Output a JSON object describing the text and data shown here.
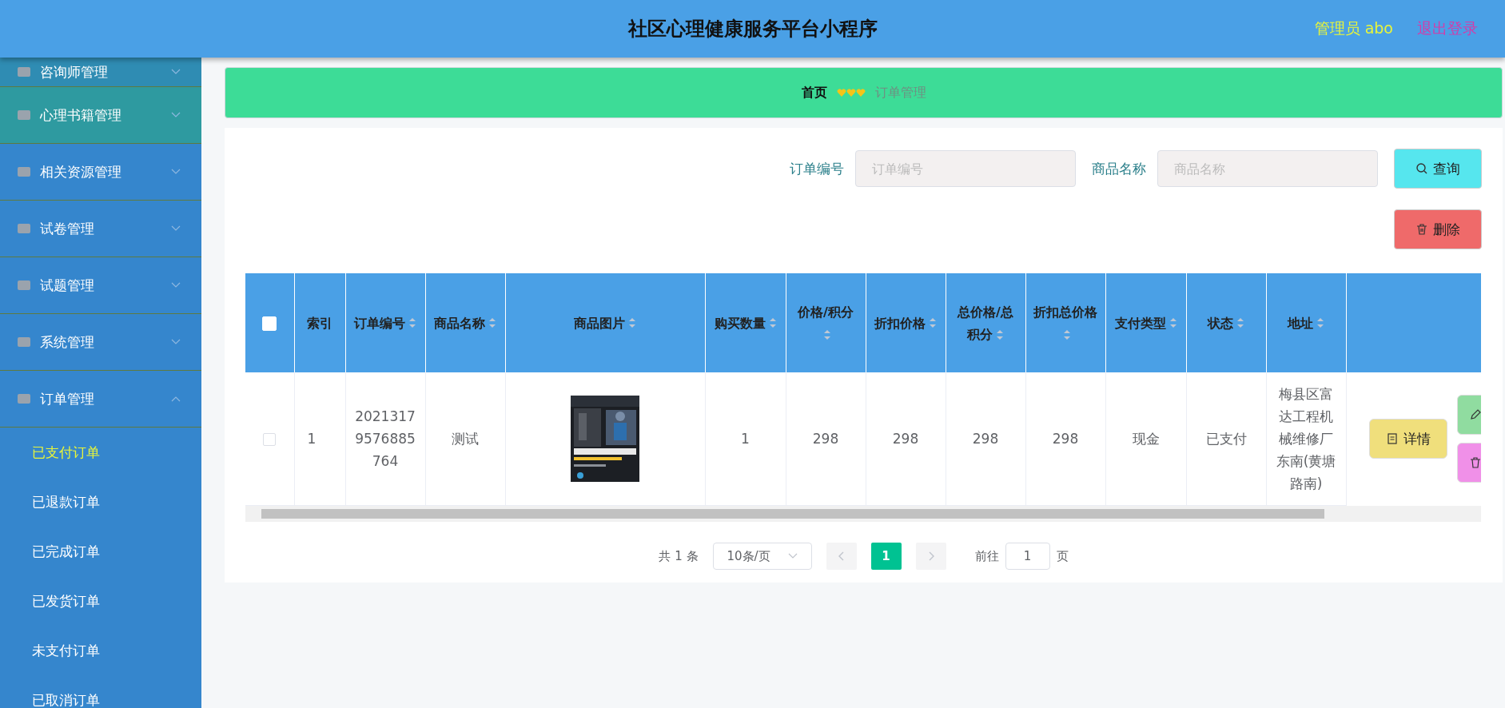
{
  "header": {
    "title": "社区心理健康服务平台小程序",
    "user": "管理员 abo",
    "logout": "退出登录"
  },
  "sidebar": {
    "items": [
      {
        "label": "咨询师管理",
        "expanded": false,
        "highlighted": false
      },
      {
        "label": "心理书籍管理",
        "expanded": false,
        "highlighted": true
      },
      {
        "label": "相关资源管理",
        "expanded": false,
        "highlighted": false
      },
      {
        "label": "试卷管理",
        "expanded": false,
        "highlighted": false
      },
      {
        "label": "试题管理",
        "expanded": false,
        "highlighted": false
      },
      {
        "label": "系统管理",
        "expanded": false,
        "highlighted": false
      },
      {
        "label": "订单管理",
        "expanded": true,
        "highlighted": false,
        "children": [
          {
            "label": "已支付订单",
            "selected": true
          },
          {
            "label": "已退款订单",
            "selected": false
          },
          {
            "label": "已完成订单",
            "selected": false
          },
          {
            "label": "已发货订单",
            "selected": false
          },
          {
            "label": "未支付订单",
            "selected": false
          },
          {
            "label": "已取消订单",
            "selected": false
          }
        ]
      }
    ]
  },
  "breadcrumb": [
    "首页",
    "订单管理"
  ],
  "search": {
    "fields": [
      {
        "label": "订单编号",
        "placeholder": "订单编号"
      },
      {
        "label": "商品名称",
        "placeholder": "商品名称"
      }
    ],
    "query_button": "查询",
    "delete_button": "删除"
  },
  "table": {
    "columns": [
      {
        "label": "索引",
        "sortable": false
      },
      {
        "label": "订单编号",
        "sortable": true
      },
      {
        "label": "商品名称",
        "sortable": true
      },
      {
        "label": "商品图片",
        "sortable": true
      },
      {
        "label": "购买数量",
        "sortable": true
      },
      {
        "label": "价格/积分",
        "sortable": true
      },
      {
        "label": "折扣价格",
        "sortable": true
      },
      {
        "label": "总价格/总积分",
        "sortable": true
      },
      {
        "label": "折扣总价格",
        "sortable": true
      },
      {
        "label": "支付类型",
        "sortable": true
      },
      {
        "label": "状态",
        "sortable": true
      },
      {
        "label": "地址",
        "sortable": true
      }
    ],
    "all_checked": false,
    "rows": [
      {
        "checked": false,
        "cells": [
          "1",
          "20213179576885764",
          "测试",
          null,
          "1",
          "298",
          "298",
          "298",
          "298",
          "现金",
          "已支付",
          "梅县区富达工程机械维修厂东南(黄塘路南)"
        ],
        "detail_button": "详情"
      }
    ]
  },
  "pagination": {
    "total": "共 1 条",
    "page_size": "10条/页",
    "pages": [
      {
        "label": "1",
        "selected": true
      }
    ],
    "goto_label": "前往",
    "goto_value": "1",
    "page_unit": "页"
  }
}
